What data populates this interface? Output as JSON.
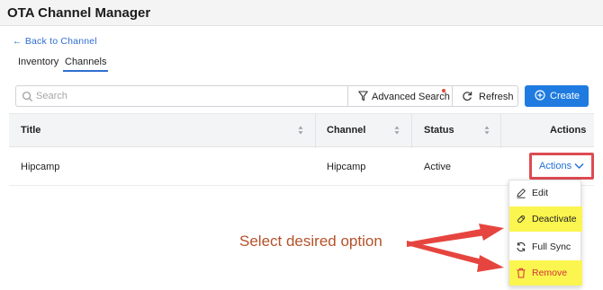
{
  "app": {
    "title": "OTA Channel Manager"
  },
  "nav": {
    "back_label": "← Back to Channel"
  },
  "tabs": [
    {
      "label": "Inventory",
      "active": false
    },
    {
      "label": "Channels",
      "active": true
    }
  ],
  "toolbar": {
    "search_placeholder": "Search",
    "advanced_search_label": "Advanced Search",
    "refresh_label": "Refresh",
    "create_label": "Create"
  },
  "table": {
    "columns": [
      "Title",
      "Channel",
      "Status",
      "Actions"
    ],
    "rows": [
      {
        "title": "Hipcamp",
        "channel": "Hipcamp",
        "status": "Active",
        "actions_label": "Actions"
      }
    ]
  },
  "actions_menu": {
    "items": [
      {
        "label": "Edit",
        "icon": "pencil-icon",
        "highlighted": false
      },
      {
        "label": "Deactivate",
        "icon": "eraser-icon",
        "highlighted": true
      },
      {
        "label": "Full Sync",
        "icon": "sync-icon",
        "highlighted": false
      },
      {
        "label": "Remove",
        "icon": "trash-icon",
        "highlighted": true
      }
    ]
  },
  "annotation": {
    "text": "Select desired option"
  },
  "colors": {
    "accent": "#1f7be0",
    "link": "#2f6fd1",
    "annotation_arrow": "#e6453f",
    "highlight_box": "#dd4b52",
    "highlight_fill": "#fbf54f",
    "annotation_text": "#b5522a"
  }
}
